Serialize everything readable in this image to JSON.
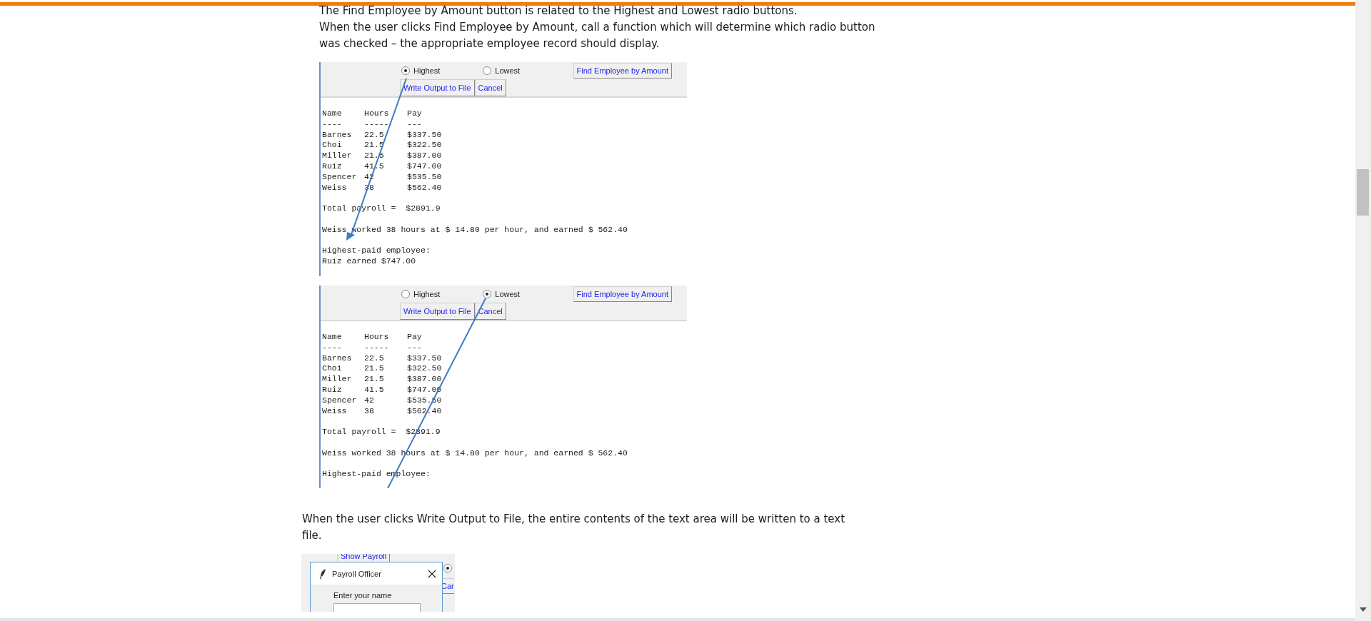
{
  "blocks": [
    {
      "kind": "paragraph",
      "sentences": [
        "The Find Employee by Amount button is related to the Highest and Lowest radio buttons.",
        "When the user clicks Find Employee by Amount, call a function which will determine which radio button was checked – the appropriate employee record should display."
      ]
    },
    {
      "kind": "payroll_capture",
      "radios": [
        {
          "label": "Highest",
          "selected": true
        },
        {
          "label": "Lowest",
          "selected": false
        }
      ],
      "find_button": "Find Employee by Amount",
      "buttons": [
        "Write Output to File",
        "Cancel"
      ],
      "columns": [
        "Name",
        "Hours",
        "Pay"
      ],
      "underlines": [
        "----",
        "-----",
        "---"
      ],
      "rows": [
        {
          "name": "Barnes",
          "hours": "22.5",
          "pay": "$337.50"
        },
        {
          "name": "Choi",
          "hours": "21.5",
          "pay": "$322.50"
        },
        {
          "name": "Miller",
          "hours": "21.5",
          "pay": "$387.00"
        },
        {
          "name": "Ruiz",
          "hours": "41.5",
          "pay": "$747.00"
        },
        {
          "name": "Spencer",
          "hours": "42",
          "pay": "$535.50"
        },
        {
          "name": "Weiss",
          "hours": "38",
          "pay": "$562.40"
        }
      ],
      "total": "Total payroll =  $2891.9",
      "summary": "Weiss worked 38 hours at $ 14.80 per hour, and earned $ 562.40",
      "result": [
        "Highest-paid employee:",
        "Ruiz earned $747.00"
      ]
    },
    {
      "kind": "payroll_capture",
      "radios": [
        {
          "label": "Highest",
          "selected": false
        },
        {
          "label": "Lowest",
          "selected": true
        }
      ],
      "find_button": "Find Employee by Amount",
      "buttons": [
        "Write Output to File",
        "Cancel"
      ],
      "columns": [
        "Name",
        "Hours",
        "Pay"
      ],
      "underlines": [
        "----",
        "-----",
        "---"
      ],
      "rows": [
        {
          "name": "Barnes",
          "hours": "22.5",
          "pay": "$337.50"
        },
        {
          "name": "Choi",
          "hours": "21.5",
          "pay": "$322.50"
        },
        {
          "name": "Miller",
          "hours": "21.5",
          "pay": "$387.00"
        },
        {
          "name": "Ruiz",
          "hours": "41.5",
          "pay": "$747.00"
        },
        {
          "name": "Spencer",
          "hours": "42",
          "pay": "$535.50"
        },
        {
          "name": "Weiss",
          "hours": "38",
          "pay": "$562.40"
        }
      ],
      "total": "Total payroll =  $2891.9",
      "summary": "Weiss worked 38 hours at $ 14.80 per hour, and earned $ 562.40",
      "result": [
        "Highest-paid employee:"
      ]
    },
    {
      "kind": "paragraph",
      "sentences": [
        "When the user clicks Write Output to File, the entire contents of the text area will be written to a text file."
      ]
    },
    {
      "kind": "dialog_capture",
      "background_buttons": [
        "Show Payroll",
        "Car"
      ],
      "background_radio": {
        "selected": true
      },
      "dialog": {
        "title": "Payroll Officer",
        "prompt": "Enter your name"
      }
    }
  ]
}
